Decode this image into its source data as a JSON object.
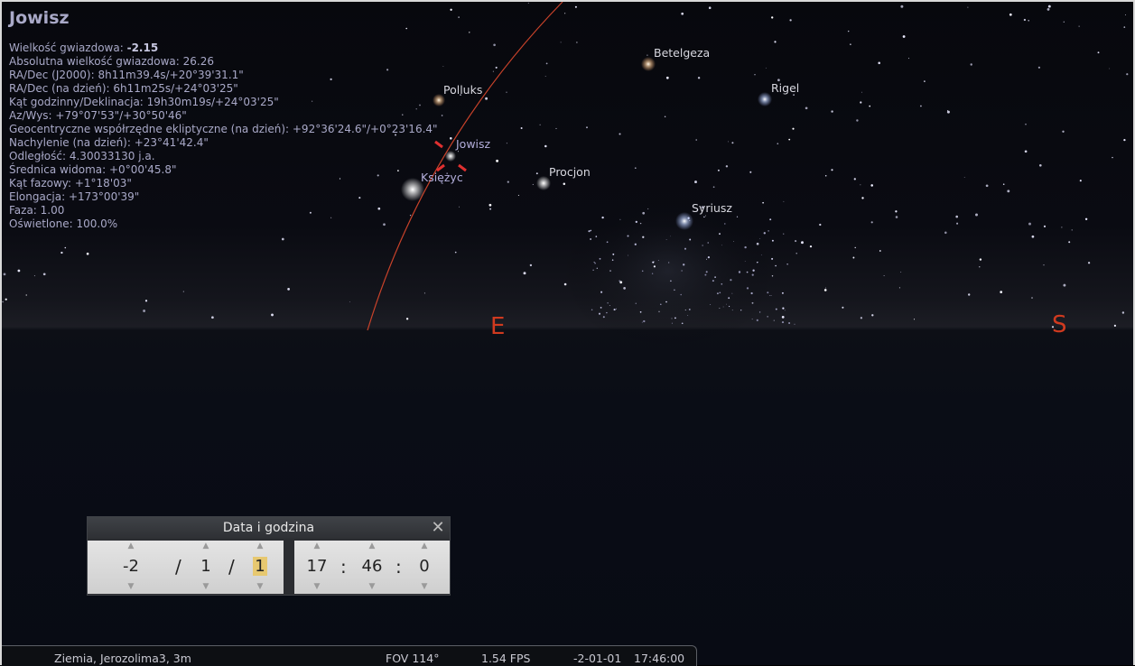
{
  "object": {
    "name": "Jowisz",
    "rows": [
      {
        "label": "Wielkość gwiazdowa: ",
        "value": "-2.15"
      },
      {
        "label": "Absolutna wielkość gwiazdowa: 26.26",
        "value": ""
      },
      {
        "label": "RA/Dec (J2000): 8h11m39.4s/+20°39'31.1\"",
        "value": ""
      },
      {
        "label": "RA/Dec (na dzień): 6h11m25s/+24°03'25\"",
        "value": ""
      },
      {
        "label": "Kąt godzinny/Deklinacja: 19h30m19s/+24°03'25\"",
        "value": ""
      },
      {
        "label": "Az/Wys: +79°07'53\"/+30°50'46\"",
        "value": ""
      },
      {
        "label": "Geocentryczne współrzędne ekliptyczne (na dzień): +92°36'24.6\"/+0°23'16.4\"",
        "value": ""
      },
      {
        "label": "Nachylenie (na dzień): +23°41'42.4\"",
        "value": ""
      },
      {
        "label": "Odległość: 4.30033130 j.a.",
        "value": ""
      },
      {
        "label": "Średnica widoma: +0°00'45.8\"",
        "value": ""
      },
      {
        "label": "Kąt fazowy: +1°18'03\"",
        "value": ""
      },
      {
        "label": "Elongacja: +173°00'39\"",
        "value": ""
      },
      {
        "label": "Faza: 1.00",
        "value": ""
      },
      {
        "label": "Oświetlone: 100.0%",
        "value": ""
      }
    ]
  },
  "sky_labels": {
    "polluks": "Polluks",
    "jowisz": "Jowisz",
    "ksiezyc": "Księżyc",
    "procjon": "Procjon",
    "betelgeza": "Betelgeza",
    "rigel": "Rigel",
    "syriusz": "Syriusz"
  },
  "cardinals": {
    "east": "E",
    "south": "S"
  },
  "dialog": {
    "title": "Data i godzina",
    "close_symbol": "✕",
    "up_symbol": "▲",
    "down_symbol": "▼",
    "year": "-2",
    "month": "1",
    "day": "1",
    "date_sep": "/",
    "hour": "17",
    "minute": "46",
    "second": "0",
    "time_sep": ":"
  },
  "status_bar": {
    "location": "Ziemia, Jerozolima3, 3m",
    "fov": "FOV 114°",
    "fps": "1.54 FPS",
    "date": "-2-01-01",
    "time": "17:46:00"
  },
  "colors": {
    "cardinal": "#d03a1f",
    "selection_marker": "#e03030",
    "ecliptic": "#c8422a",
    "info_text": "#a9a9c8"
  }
}
